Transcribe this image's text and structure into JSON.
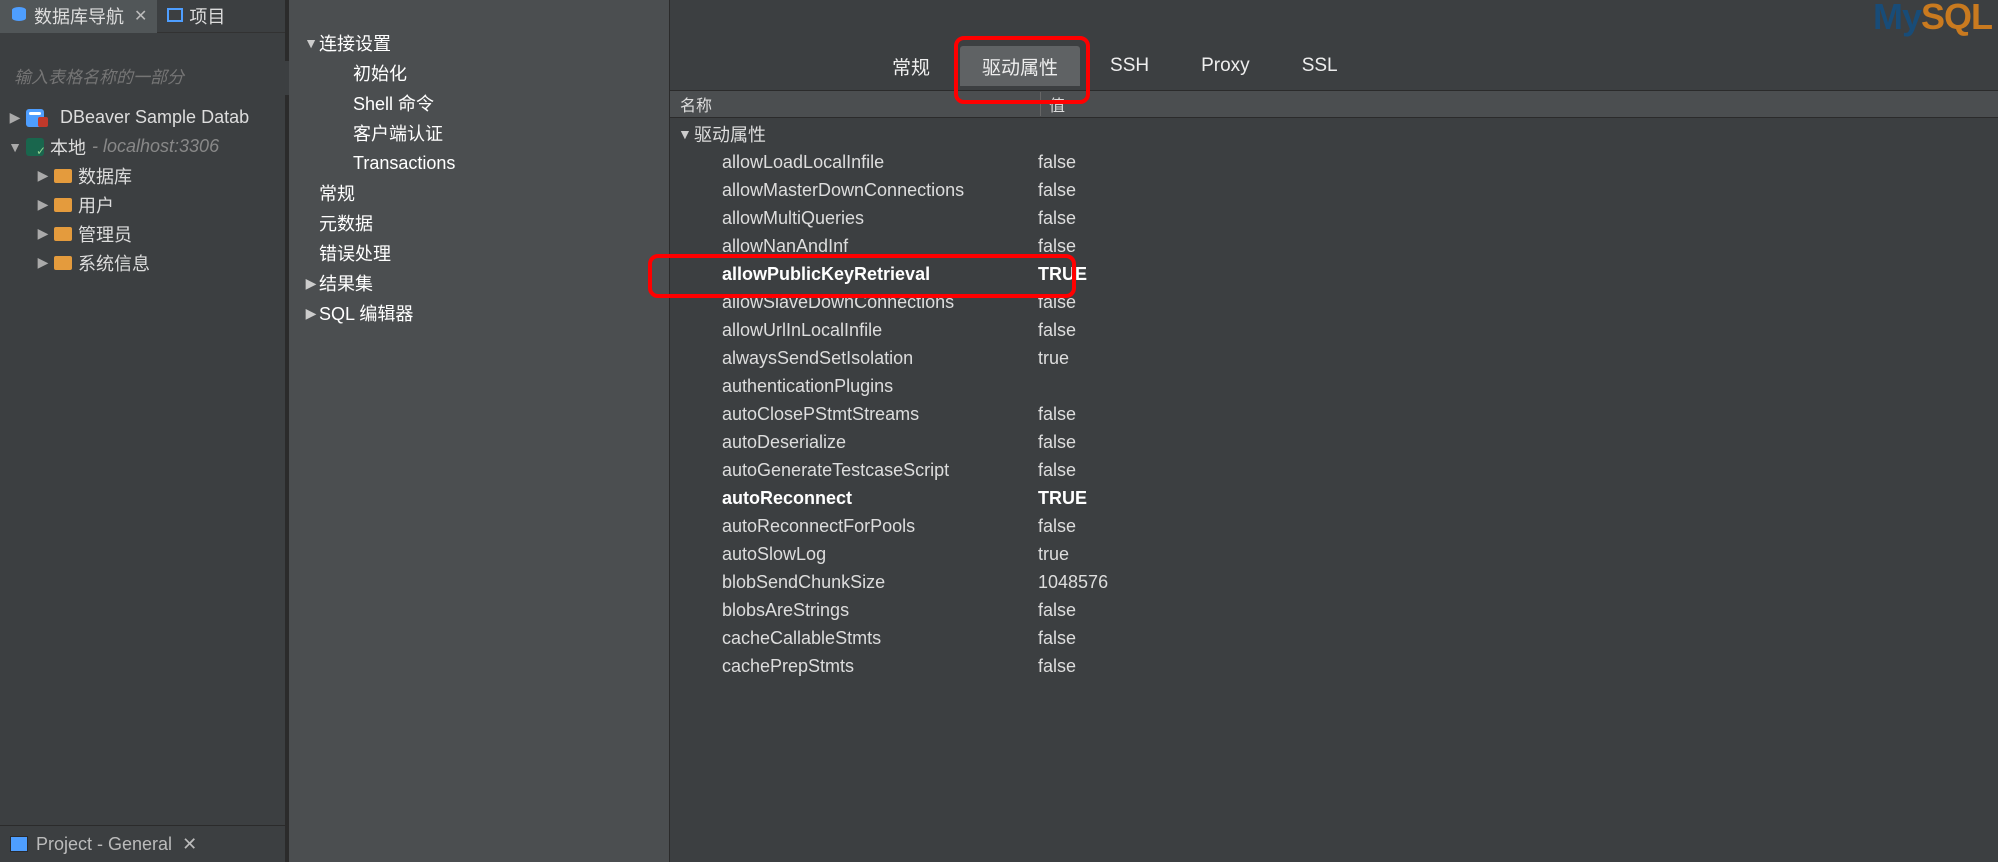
{
  "sidebar": {
    "tabs": [
      {
        "label": "数据库导航",
        "icon": "database-icon",
        "active": true,
        "closable": true
      },
      {
        "label": "项目",
        "icon": "project-icon",
        "active": false,
        "closable": false
      }
    ],
    "filter_placeholder": "输入表格名称的一部分",
    "tree": [
      {
        "depth": 0,
        "expand": "▶",
        "icon": "db",
        "label": "DBeaver Sample Datab",
        "extra": "",
        "badge": "error"
      },
      {
        "depth": 0,
        "expand": "▼",
        "icon": "mysql",
        "label": "本地",
        "extra": "- localhost:3306"
      },
      {
        "depth": 1,
        "expand": "▶",
        "icon": "folder",
        "label": "数据库"
      },
      {
        "depth": 1,
        "expand": "▶",
        "icon": "folder",
        "label": "用户"
      },
      {
        "depth": 1,
        "expand": "▶",
        "icon": "folder",
        "label": "管理员"
      },
      {
        "depth": 1,
        "expand": "▶",
        "icon": "folder",
        "label": "系统信息"
      }
    ],
    "bottom_tab": "Project - General"
  },
  "middle_nav": {
    "items": [
      {
        "depth": 1,
        "expand": "▼",
        "label": "连接设置"
      },
      {
        "depth": 2,
        "expand": "",
        "label": "初始化"
      },
      {
        "depth": 2,
        "expand": "",
        "label": "Shell 命令"
      },
      {
        "depth": 2,
        "expand": "",
        "label": "客户端认证"
      },
      {
        "depth": 2,
        "expand": "",
        "label": "Transactions"
      },
      {
        "depth": 1,
        "expand": "",
        "label": "常规"
      },
      {
        "depth": 1,
        "expand": "",
        "label": "元数据"
      },
      {
        "depth": 1,
        "expand": "",
        "label": "错误处理"
      },
      {
        "depth": 1,
        "expand": "▶",
        "label": "结果集"
      },
      {
        "depth": 1,
        "expand": "▶",
        "label": "SQL 编辑器"
      }
    ]
  },
  "right": {
    "logo_my": "My",
    "logo_sql": "SQL",
    "tabs": [
      {
        "label": "常规",
        "active": false
      },
      {
        "label": "驱动属性",
        "active": true
      },
      {
        "label": "SSH",
        "active": false
      },
      {
        "label": "Proxy",
        "active": false
      },
      {
        "label": "SSL",
        "active": false
      }
    ],
    "col_name": "名称",
    "col_value": "值",
    "section": "驱动属性",
    "properties": [
      {
        "name": "allowLoadLocalInfile",
        "value": "false",
        "bold": false
      },
      {
        "name": "allowMasterDownConnections",
        "value": "false",
        "bold": false
      },
      {
        "name": "allowMultiQueries",
        "value": "false",
        "bold": false
      },
      {
        "name": "allowNanAndInf",
        "value": "false",
        "bold": false
      },
      {
        "name": "allowPublicKeyRetrieval",
        "value": "TRUE",
        "bold": true
      },
      {
        "name": "allowSlaveDownConnections",
        "value": "false",
        "bold": false
      },
      {
        "name": "allowUrlInLocalInfile",
        "value": "false",
        "bold": false
      },
      {
        "name": "alwaysSendSetIsolation",
        "value": "true",
        "bold": false
      },
      {
        "name": "authenticationPlugins",
        "value": "",
        "bold": false
      },
      {
        "name": "autoClosePStmtStreams",
        "value": "false",
        "bold": false
      },
      {
        "name": "autoDeserialize",
        "value": "false",
        "bold": false
      },
      {
        "name": "autoGenerateTestcaseScript",
        "value": "false",
        "bold": false
      },
      {
        "name": "autoReconnect",
        "value": "TRUE",
        "bold": true
      },
      {
        "name": "autoReconnectForPools",
        "value": "false",
        "bold": false
      },
      {
        "name": "autoSlowLog",
        "value": "true",
        "bold": false
      },
      {
        "name": "blobSendChunkSize",
        "value": "1048576",
        "bold": false
      },
      {
        "name": "blobsAreStrings",
        "value": "false",
        "bold": false
      },
      {
        "name": "cacheCallableStmts",
        "value": "false",
        "bold": false
      },
      {
        "name": "cachePrepStmts",
        "value": "false",
        "bold": false
      }
    ]
  }
}
